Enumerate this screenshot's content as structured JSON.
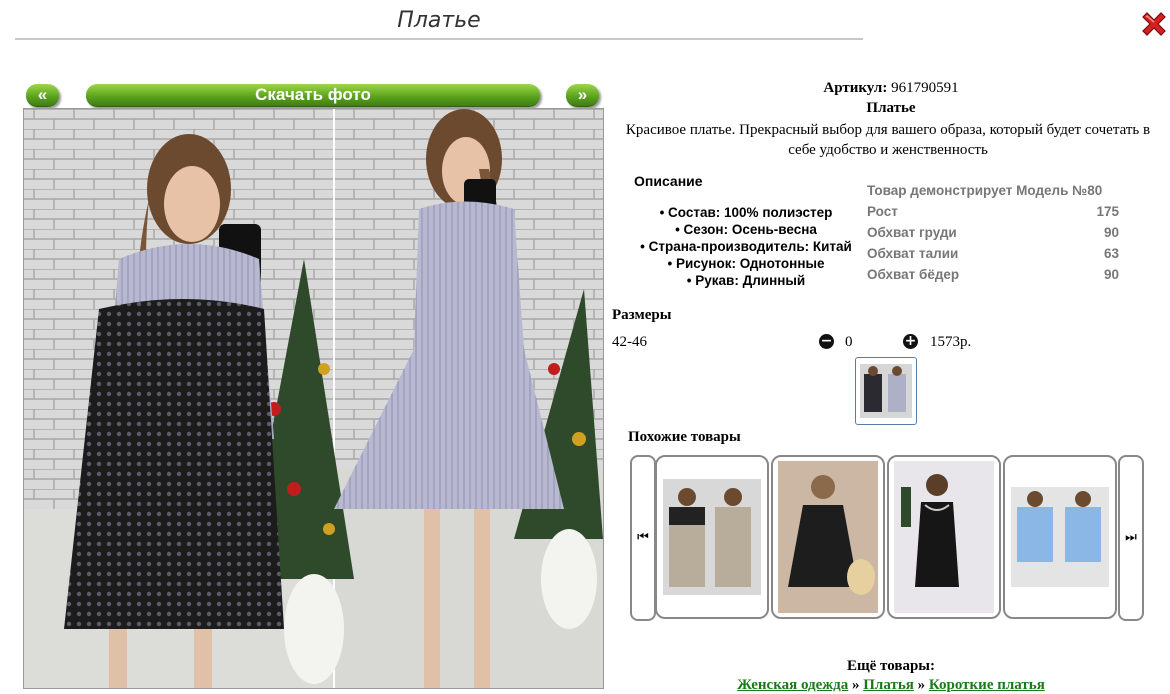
{
  "header": {
    "title": "Платье"
  },
  "gallery": {
    "prev_label": "«",
    "download_label": "Скачать фото",
    "next_label": "»"
  },
  "product": {
    "article_label": "Артикул:",
    "article_value": "961790591",
    "name": "Платье",
    "description": "Красивое платье. Прекрасный выбор для вашего образа, который будет сочетать в себе удобство и женственность"
  },
  "details": {
    "heading": "Описание",
    "items": [
      "Состав: 100% полиэстер",
      "Сезон: Осень-весна",
      "Страна-производитель: Китай",
      "Рисунок: Однотонные",
      "Рукав: Длинный"
    ]
  },
  "model": {
    "heading": "Товар демонстрирует Модель №80",
    "rows": [
      {
        "label": "Рост",
        "value": "175"
      },
      {
        "label": "Обхват груди",
        "value": "90"
      },
      {
        "label": "Обхват талии",
        "value": "63"
      },
      {
        "label": "Обхват бёдер",
        "value": "90"
      }
    ]
  },
  "sizes": {
    "heading": "Размеры",
    "size": "42-46",
    "quantity": "0",
    "price": "1573р."
  },
  "similar": {
    "heading": "Похожие товары",
    "prev_icon": "⏮",
    "next_icon": "⏭"
  },
  "more": {
    "heading": "Ещё товары:",
    "crumbs": [
      "Женская одежда",
      "Платья",
      "Короткие платья"
    ],
    "separator": "»"
  },
  "icons": {
    "close": "close-x-icon",
    "minus": "minus-circle-icon",
    "plus": "plus-circle-icon"
  },
  "colors": {
    "accent_green": "#5da51e",
    "close_red": "#d42020",
    "link_green": "#1a7a1a"
  }
}
